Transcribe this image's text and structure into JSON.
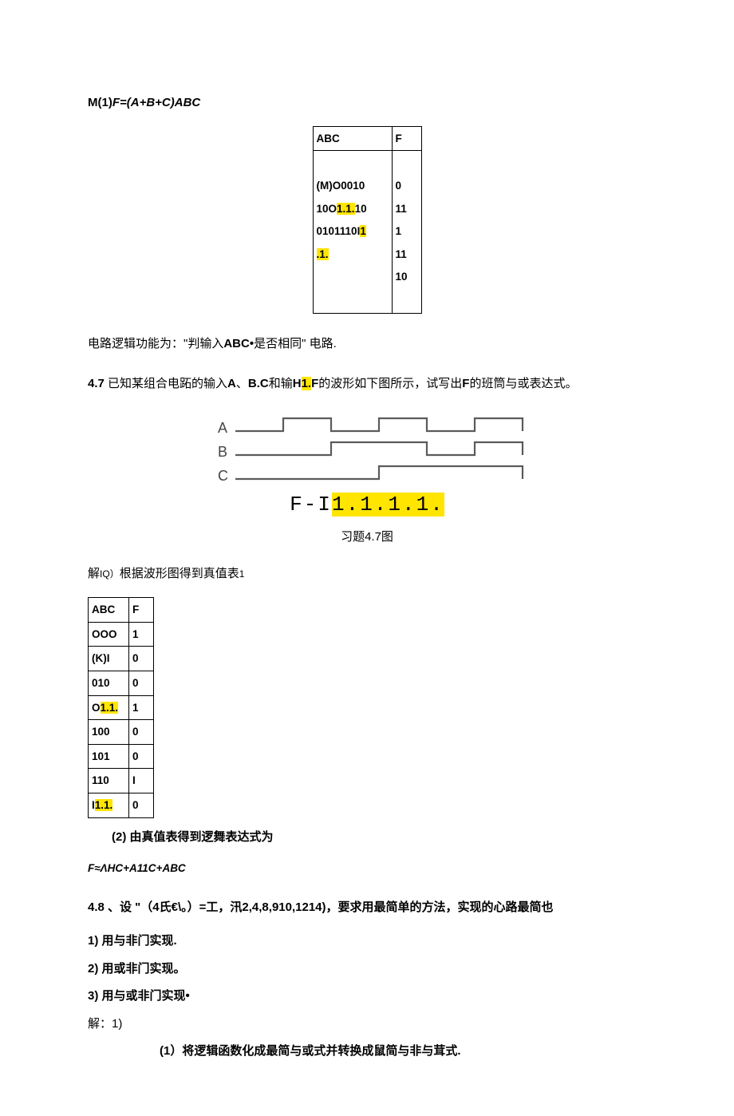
{
  "answer_prefix": "M(1)",
  "formula_answer": "F=(A+B+C)ABC",
  "table1": {
    "header_a": "ABC",
    "header_b": "F",
    "body_a_1": "(M)O0010",
    "body_a_2_pre": "10O",
    "body_a_2_hl": "1.1.",
    "body_a_2_post": "10",
    "body_a_3_pre": "0101110I",
    "body_a_3_hl": "1",
    "body_a_4_hl": ".1.",
    "body_b_1": "0",
    "body_b_2": "11",
    "body_b_3": "1",
    "body_b_4": "11",
    "body_b_5": "10"
  },
  "logic_desc_pre": "电路逻辑功能为：\"判输入",
  "logic_desc_bold": "ABC•",
  "logic_desc_post": "是否相同\" 电路.",
  "q47_num": "4.7",
  "q47_seg1": "    已知某组合电跖的输入",
  "q47_bold1": "A",
  "q47_seg2": "、",
  "q47_bold2": "B.C",
  "q47_seg3": "和输",
  "q47_bold3_pre": "H",
  "q47_bold3_hl": "1.",
  "q47_bold3_post": "F",
  "q47_seg4": "的波形如下图所示，试写出",
  "q47_bold4": "F",
  "q47_seg5": "的班筒与或表达式。",
  "wave_labels": {
    "a": "A",
    "b": "B",
    "c": "C"
  },
  "formula_fi_pre": "F-I",
  "formula_fi_hl": "1.1.1.1.",
  "caption_47": "习题4.7图",
  "sol_iq_pre": "解",
  "sol_iq_sub": "IQ）",
  "sol_iq_post": "根据波形图得到真值表",
  "sol_iq_suffix": "1",
  "table2": {
    "rows": [
      {
        "a": "ABC",
        "f": "F"
      },
      {
        "a": "OOO",
        "f": "1"
      },
      {
        "a": "(K)I",
        "f": "0"
      },
      {
        "a": "010",
        "f": "0"
      },
      {
        "a_pre": "O",
        "a_hl": "1.1.",
        "f": "1"
      },
      {
        "a": "100",
        "f": "0"
      },
      {
        "a": "101",
        "f": "0"
      },
      {
        "a": "110",
        "f": "I"
      },
      {
        "a_pre": "I",
        "a_hl": "1.1.",
        "f": "0"
      }
    ]
  },
  "line_2": "(2) 由真值表得到逻舞表达式为",
  "formula_48": "F≈ΛHC+A11C+ABC",
  "q48_line": "4.8   、设 \"（4氏€\\。）=工，汛2,4,8,910,1214)，要求用最简单的方法，实现的心路最简也",
  "q48_1": "1) 用与非门实现.",
  "q48_2": "2) 用或非门实现。",
  "q48_3": "3) 用与或非门实现•",
  "q48_sol_head": "解：1)",
  "q48_sol_sub": "(1）将逻辑函数化成最简与或式并转换成鼠简与非与茸式."
}
